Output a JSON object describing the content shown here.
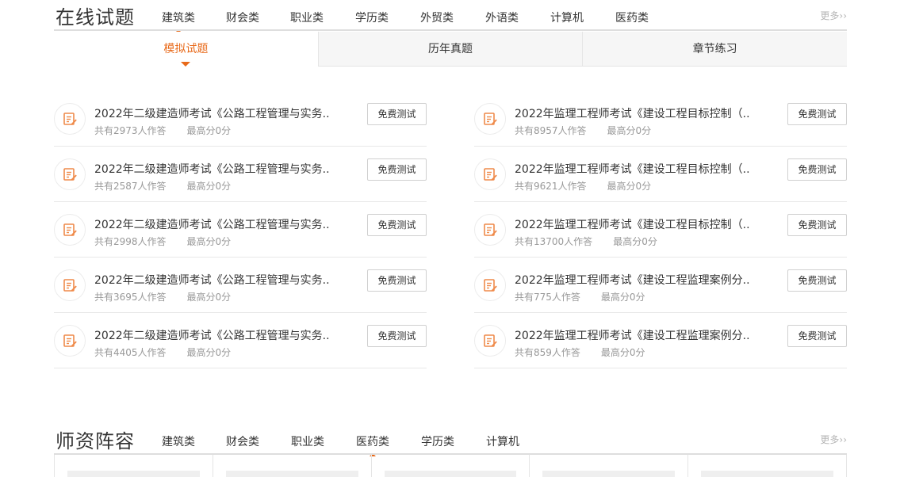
{
  "online_exam": {
    "title": "在线试题",
    "categories": [
      "建筑类",
      "财会类",
      "职业类",
      "学历类",
      "外贸类",
      "外语类",
      "计算机",
      "医药类"
    ],
    "more": "更多››",
    "tabs": [
      "模拟试题",
      "历年真题",
      "章节练习"
    ],
    "left_list": [
      {
        "title": "2022年二级建造师考试《公路工程管理与实务..",
        "takers": "共有2973人作答",
        "score": "最高分0分",
        "button": "免费测试"
      },
      {
        "title": "2022年二级建造师考试《公路工程管理与实务..",
        "takers": "共有2587人作答",
        "score": "最高分0分",
        "button": "免费测试"
      },
      {
        "title": "2022年二级建造师考试《公路工程管理与实务..",
        "takers": "共有2998人作答",
        "score": "最高分0分",
        "button": "免费测试"
      },
      {
        "title": "2022年二级建造师考试《公路工程管理与实务..",
        "takers": "共有3695人作答",
        "score": "最高分0分",
        "button": "免费测试"
      },
      {
        "title": "2022年二级建造师考试《公路工程管理与实务..",
        "takers": "共有4405人作答",
        "score": "最高分0分",
        "button": "免费测试"
      }
    ],
    "right_list": [
      {
        "title": "2022年监理工程师考试《建设工程目标控制（..",
        "takers": "共有8957人作答",
        "score": "最高分0分",
        "button": "免费测试"
      },
      {
        "title": "2022年监理工程师考试《建设工程目标控制（..",
        "takers": "共有9621人作答",
        "score": "最高分0分",
        "button": "免费测试"
      },
      {
        "title": "2022年监理工程师考试《建设工程目标控制（..",
        "takers": "共有13700人作答",
        "score": "最高分0分",
        "button": "免费测试"
      },
      {
        "title": "2022年监理工程师考试《建设工程监理案例分..",
        "takers": "共有775人作答",
        "score": "最高分0分",
        "button": "免费测试"
      },
      {
        "title": "2022年监理工程师考试《建设工程监理案例分..",
        "takers": "共有859人作答",
        "score": "最高分0分",
        "button": "免费测试"
      }
    ]
  },
  "teachers": {
    "title": "师资阵容",
    "categories": [
      "建筑类",
      "财会类",
      "职业类",
      "医药类",
      "学历类",
      "计算机"
    ],
    "more": "更多››"
  },
  "colors": {
    "accent": "#e86a1a",
    "text": "#333333",
    "muted": "#999999"
  },
  "icons": {
    "exam": "exam-paper-pencil-icon",
    "indicator": "triangle-indicator-icon"
  }
}
